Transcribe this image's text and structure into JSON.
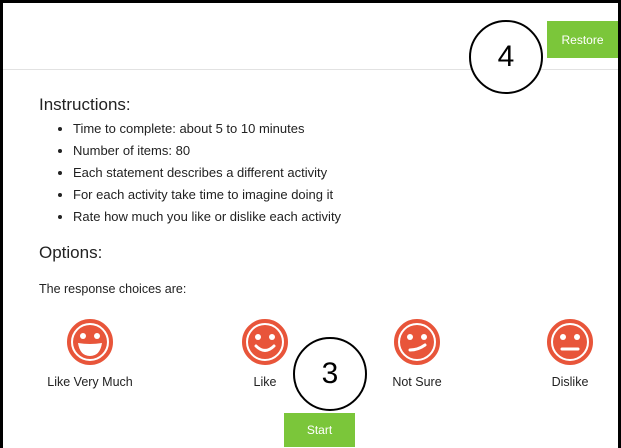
{
  "header": {
    "restore_label": "Restore"
  },
  "callouts": {
    "top": "4",
    "bottom": "3"
  },
  "instructions": {
    "heading": "Instructions:",
    "items": [
      "Time to complete: about 5 to 10 minutes",
      "Number of items: 80",
      "Each statement describes a different activity",
      "For each activity take time to imagine doing it",
      "Rate how much you like or dislike each activity"
    ]
  },
  "options": {
    "heading": "Options:",
    "intro": "The response choices are:",
    "choices": [
      {
        "label": "Like Very Much",
        "icon": "laughing-face-icon"
      },
      {
        "label": "Like",
        "icon": "smiling-face-icon"
      },
      {
        "label": "Not Sure",
        "icon": "unsure-face-icon"
      },
      {
        "label": "Dislike",
        "icon": "neutral-face-icon"
      }
    ]
  },
  "start_label": "Start",
  "colors": {
    "accent": "#7bc63a",
    "face": "#e8553a"
  }
}
